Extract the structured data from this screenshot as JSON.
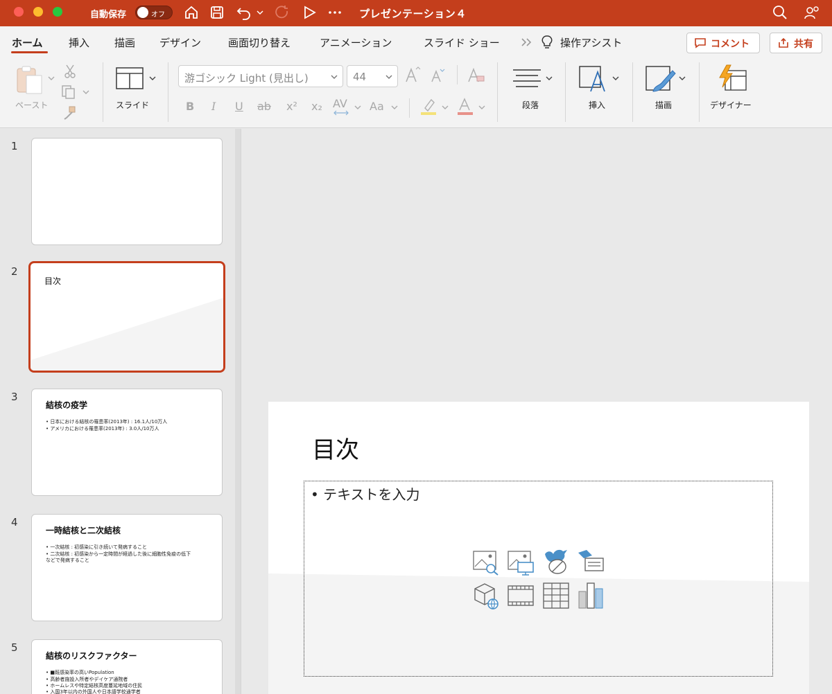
{
  "titlebar": {
    "autosave_label": "自動保存",
    "autosave_state": "オフ",
    "title": "プレゼンテーション４"
  },
  "tabs": [
    {
      "label": "ホーム"
    },
    {
      "label": "挿入"
    },
    {
      "label": "描画"
    },
    {
      "label": "デザイン"
    },
    {
      "label": "画面切り替え"
    },
    {
      "label": "アニメーション"
    },
    {
      "label": "スライド ショー"
    },
    {
      "label": "操作アシスト"
    }
  ],
  "header_buttons": {
    "comment": "コメント",
    "share": "共有"
  },
  "ribbon": {
    "paste_label": "ペースト",
    "slide_label": "スライド",
    "font_name": "游ゴシック Light (見出し)",
    "font_size": "44",
    "paragraph_label": "段落",
    "insert_label": "挿入",
    "draw_label": "描画",
    "designer_label": "デザイナー",
    "format_buttons": [
      "B",
      "I",
      "U",
      "ab",
      "x²",
      "x₂",
      "AV",
      "Aa"
    ]
  },
  "slides": [
    {
      "num": "1",
      "title": "",
      "bullets": []
    },
    {
      "num": "2",
      "title": "目次",
      "bullets": []
    },
    {
      "num": "3",
      "title": "結核の疫学",
      "bullets": [
        "• 日本における結核の罹患率(2013年) : 16.1人/10万人",
        "• アメリカにおける罹患率(2013年) : 3.0人/10万人"
      ]
    },
    {
      "num": "4",
      "title": "一時結核と二次結核",
      "bullets": [
        "• 一次結核 : 初感染に引き続いて発病すること",
        "• 二次結核 : 初感染から一定時間が経過した後に細胞性免疫の低下",
        "   などで発病すること"
      ]
    },
    {
      "num": "5",
      "title": "結核のリスクファクター",
      "bullets": [
        "• ■既感染率の高いPopulation",
        "    • 高齢者施設入所者やデイケア通院者",
        "    • ホームレスや特定結核高度蔓延地域の住民",
        "    • 入国3年以内の外国人や日本語学校通学者"
      ]
    }
  ],
  "main_slide": {
    "title": "目次",
    "placeholder": "• テキストを入力"
  },
  "colors": {
    "accent": "#c43e1c",
    "icon_blue": "#4a90c8"
  }
}
